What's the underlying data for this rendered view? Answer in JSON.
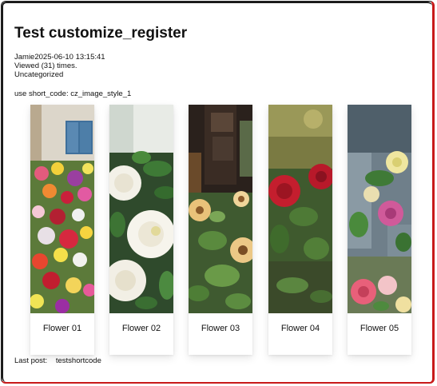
{
  "post": {
    "title": "Test customize_register",
    "author_date": "Jamie2025-06-10 13:15:41",
    "views": "Viewed (31) times.",
    "category": "Uncategorized",
    "shortcode_note": "use short_code: cz_image_style_1"
  },
  "gallery": {
    "items": [
      {
        "caption": "Flower 01"
      },
      {
        "caption": "Flower 02"
      },
      {
        "caption": "Flower 03"
      },
      {
        "caption": "Flower 04"
      },
      {
        "caption": "Flower 05"
      }
    ]
  },
  "footer": {
    "last_post_label": "Last post:",
    "last_post_link": "testshortcode"
  },
  "colors": {
    "accent_border": "#c81a1a"
  }
}
